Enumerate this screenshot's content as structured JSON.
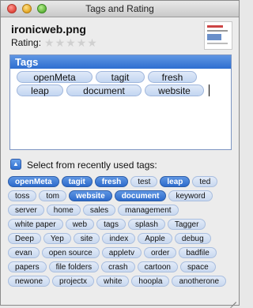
{
  "window": {
    "title": "Tags and Rating"
  },
  "file": {
    "name": "ironicweb.png"
  },
  "rating": {
    "label": "Rating:",
    "stars_total": 5,
    "stars_filled": 0
  },
  "tags_panel": {
    "header": "Tags",
    "rows": [
      [
        "openMeta",
        "tagit",
        "fresh"
      ],
      [
        "leap",
        "document",
        "website"
      ]
    ]
  },
  "recent": {
    "label": "Select from recently used tags:",
    "rows": [
      [
        {
          "t": "openMeta",
          "s": true
        },
        {
          "t": "tagit",
          "s": true
        },
        {
          "t": "fresh",
          "s": true
        },
        {
          "t": "test",
          "s": false
        },
        {
          "t": "leap",
          "s": true
        },
        {
          "t": "ted",
          "s": false
        }
      ],
      [
        {
          "t": "toss",
          "s": false
        },
        {
          "t": "tom",
          "s": false
        },
        {
          "t": "website",
          "s": true
        },
        {
          "t": "document",
          "s": true
        },
        {
          "t": "keyword",
          "s": false
        }
      ],
      [
        {
          "t": "server",
          "s": false
        },
        {
          "t": "home",
          "s": false
        },
        {
          "t": "sales",
          "s": false
        },
        {
          "t": "management",
          "s": false
        }
      ],
      [
        {
          "t": "white paper",
          "s": false
        },
        {
          "t": "web",
          "s": false
        },
        {
          "t": "tags",
          "s": false
        },
        {
          "t": "splash",
          "s": false
        },
        {
          "t": "Tagger",
          "s": false
        }
      ],
      [
        {
          "t": "Deep",
          "s": false
        },
        {
          "t": "Yep",
          "s": false
        },
        {
          "t": "site",
          "s": false
        },
        {
          "t": "index",
          "s": false
        },
        {
          "t": "Apple",
          "s": false
        },
        {
          "t": "debug",
          "s": false
        }
      ],
      [
        {
          "t": "evan",
          "s": false
        },
        {
          "t": "open source",
          "s": false
        },
        {
          "t": "appletv",
          "s": false
        },
        {
          "t": "order",
          "s": false
        },
        {
          "t": "badfile",
          "s": false
        }
      ],
      [
        {
          "t": "papers",
          "s": false
        },
        {
          "t": "file folders",
          "s": false
        },
        {
          "t": "crash",
          "s": false
        },
        {
          "t": "cartoon",
          "s": false
        },
        {
          "t": "space",
          "s": false
        }
      ],
      [
        {
          "t": "newone",
          "s": false
        },
        {
          "t": "projectx",
          "s": false
        },
        {
          "t": "white",
          "s": false
        },
        {
          "t": "hoopla",
          "s": false
        },
        {
          "t": "anotherone",
          "s": false
        }
      ]
    ]
  }
}
